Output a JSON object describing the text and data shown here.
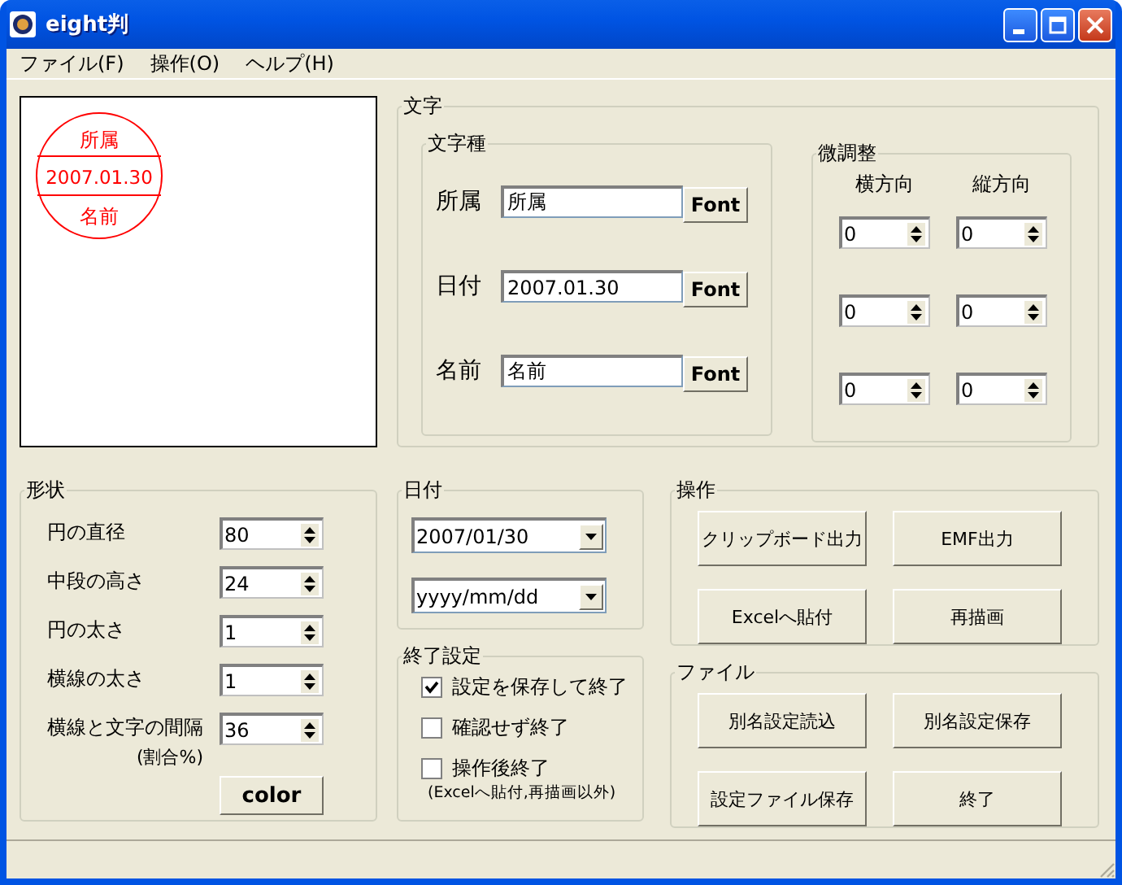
{
  "window": {
    "title": "eight判"
  },
  "menu": [
    {
      "label": "ファイル(F)"
    },
    {
      "label": "操作(O)"
    },
    {
      "label": "ヘルプ(H)"
    }
  ],
  "preview": {
    "top": "所属",
    "date": "2007.01.30",
    "bottom": "名前"
  },
  "text_group": {
    "title": "文字",
    "types": {
      "title": "文字種",
      "rows": [
        {
          "label": "所属",
          "value": "所属",
          "button": "Font"
        },
        {
          "label": "日付",
          "value": "2007.01.30",
          "button": "Font"
        },
        {
          "label": "名前",
          "value": "名前",
          "button": "Font"
        }
      ]
    },
    "adjust": {
      "title": "微調整",
      "columns": [
        "横方向",
        "縦方向"
      ],
      "rows": [
        [
          "0",
          "0"
        ],
        [
          "0",
          "0"
        ],
        [
          "0",
          "0"
        ]
      ]
    }
  },
  "shape": {
    "title": "形状",
    "rows": [
      {
        "label": "円の直径",
        "value": "80"
      },
      {
        "label": "中段の高さ",
        "value": "24"
      },
      {
        "label": "円の太さ",
        "value": "1"
      },
      {
        "label": "横線の太さ",
        "value": "1"
      },
      {
        "label": "横線と文字の間隔",
        "note": "(割合%)",
        "value": "36"
      }
    ],
    "button": "color"
  },
  "date": {
    "title": "日付",
    "combos": [
      "2007/01/30",
      "yyyy/mm/dd"
    ]
  },
  "exit": {
    "title": "終了設定",
    "options": [
      {
        "label": "設定を保存して終了",
        "checked": true
      },
      {
        "label": "確認せず終了",
        "checked": false
      },
      {
        "label": "操作後終了",
        "checked": false
      }
    ],
    "note": "(Excelへ貼付,再描画以外)"
  },
  "ops": {
    "title": "操作",
    "buttons": [
      "クリップボード出力",
      "EMF出力",
      "Excelへ貼付",
      "再描画"
    ]
  },
  "file": {
    "title": "ファイル",
    "buttons": [
      "別名設定読込",
      "別名設定保存",
      "設定ファイル保存",
      "終了"
    ]
  }
}
